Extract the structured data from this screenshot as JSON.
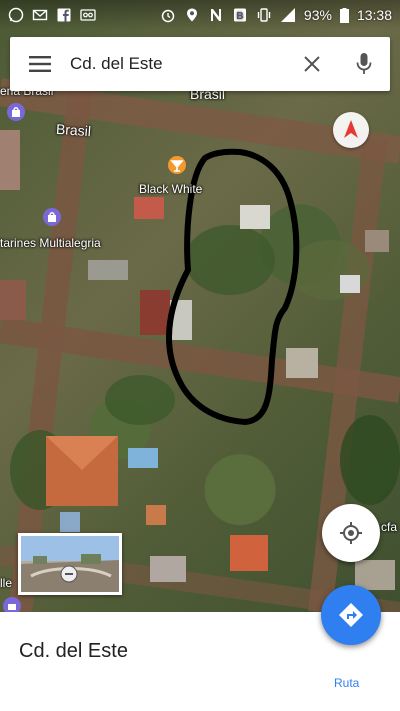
{
  "status_bar": {
    "battery_percent": "93%",
    "time": "13:38",
    "left_icons": [
      "whatsapp-icon",
      "mail-icon",
      "facebook-icon",
      "voicemail-icon"
    ],
    "right_icons": [
      "alarm-icon",
      "location-icon",
      "n-icon",
      "b-icon",
      "vibrate-icon",
      "signal-icon"
    ]
  },
  "search": {
    "query": "Cd. del Este"
  },
  "map": {
    "labels": {
      "street_top": "Brasil",
      "street_left": "Brasil",
      "poi_bar": "Black White",
      "poi_shop": "tarines Multialegria",
      "edge_top_left": "ena Brasil",
      "edge_bottom_left": "lle",
      "edge_right": "cfa"
    },
    "colors": {
      "annotation_stroke": "#000000",
      "poi_orange": "#f39a2b",
      "poi_purple": "#7b68d8",
      "compass_red": "#e53935"
    }
  },
  "place": {
    "title": "Cd. del Este",
    "route_label": "Ruta"
  },
  "colors": {
    "accent_blue": "#2f7ff0"
  }
}
